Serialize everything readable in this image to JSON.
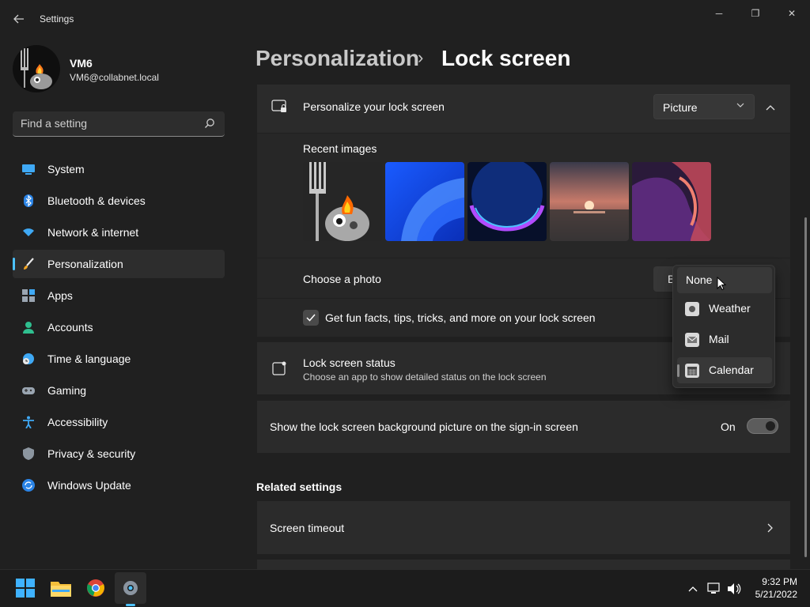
{
  "window": {
    "title": "Settings",
    "controls": {
      "minimize": "─",
      "maximize": "❐",
      "close": "✕"
    }
  },
  "user": {
    "name": "VM6",
    "email": "VM6@collabnet.local"
  },
  "search": {
    "placeholder": "Find a setting"
  },
  "sidebar": {
    "items": [
      {
        "label": "System",
        "icon": "monitor-icon"
      },
      {
        "label": "Bluetooth & devices",
        "icon": "bluetooth-icon"
      },
      {
        "label": "Network & internet",
        "icon": "wifi-icon"
      },
      {
        "label": "Personalization",
        "icon": "brush-icon",
        "selected": true
      },
      {
        "label": "Apps",
        "icon": "apps-icon"
      },
      {
        "label": "Accounts",
        "icon": "person-icon"
      },
      {
        "label": "Time & language",
        "icon": "globe-clock-icon"
      },
      {
        "label": "Gaming",
        "icon": "gamepad-icon"
      },
      {
        "label": "Accessibility",
        "icon": "accessibility-icon"
      },
      {
        "label": "Privacy & security",
        "icon": "shield-icon"
      },
      {
        "label": "Windows Update",
        "icon": "update-icon"
      }
    ]
  },
  "breadcrumb": {
    "parent": "Personalization",
    "separator": "›",
    "current": "Lock screen"
  },
  "lock_screen": {
    "personalize_label": "Personalize your lock screen",
    "personalize_value": "Picture",
    "recent_images_label": "Recent images",
    "choose_photo_label": "Choose a photo",
    "choose_photo_button_partial": "B",
    "fun_facts_label": "Get fun facts, tips, tricks, and more on your lock screen",
    "fun_facts_checked": true,
    "status_title": "Lock screen status",
    "status_subtitle": "Choose an app to show detailed status on the lock screen",
    "status_dropdown": {
      "options": [
        {
          "label": "None",
          "icon": ""
        },
        {
          "label": "Weather",
          "icon": "weather-icon"
        },
        {
          "label": "Mail",
          "icon": "mail-icon"
        },
        {
          "label": "Calendar",
          "icon": "calendar-icon"
        }
      ],
      "selected": "Calendar",
      "hovered": "None"
    },
    "signin_bg_label": "Show the lock screen background picture on the sign-in screen",
    "signin_bg_state": "On"
  },
  "related": {
    "heading": "Related settings",
    "items": [
      {
        "label": "Screen timeout"
      }
    ]
  },
  "taskbar": {
    "apps": [
      "start-icon",
      "file-explorer-icon",
      "chrome-icon",
      "settings-icon"
    ],
    "time": "9:32 PM",
    "date": "5/21/2022"
  }
}
